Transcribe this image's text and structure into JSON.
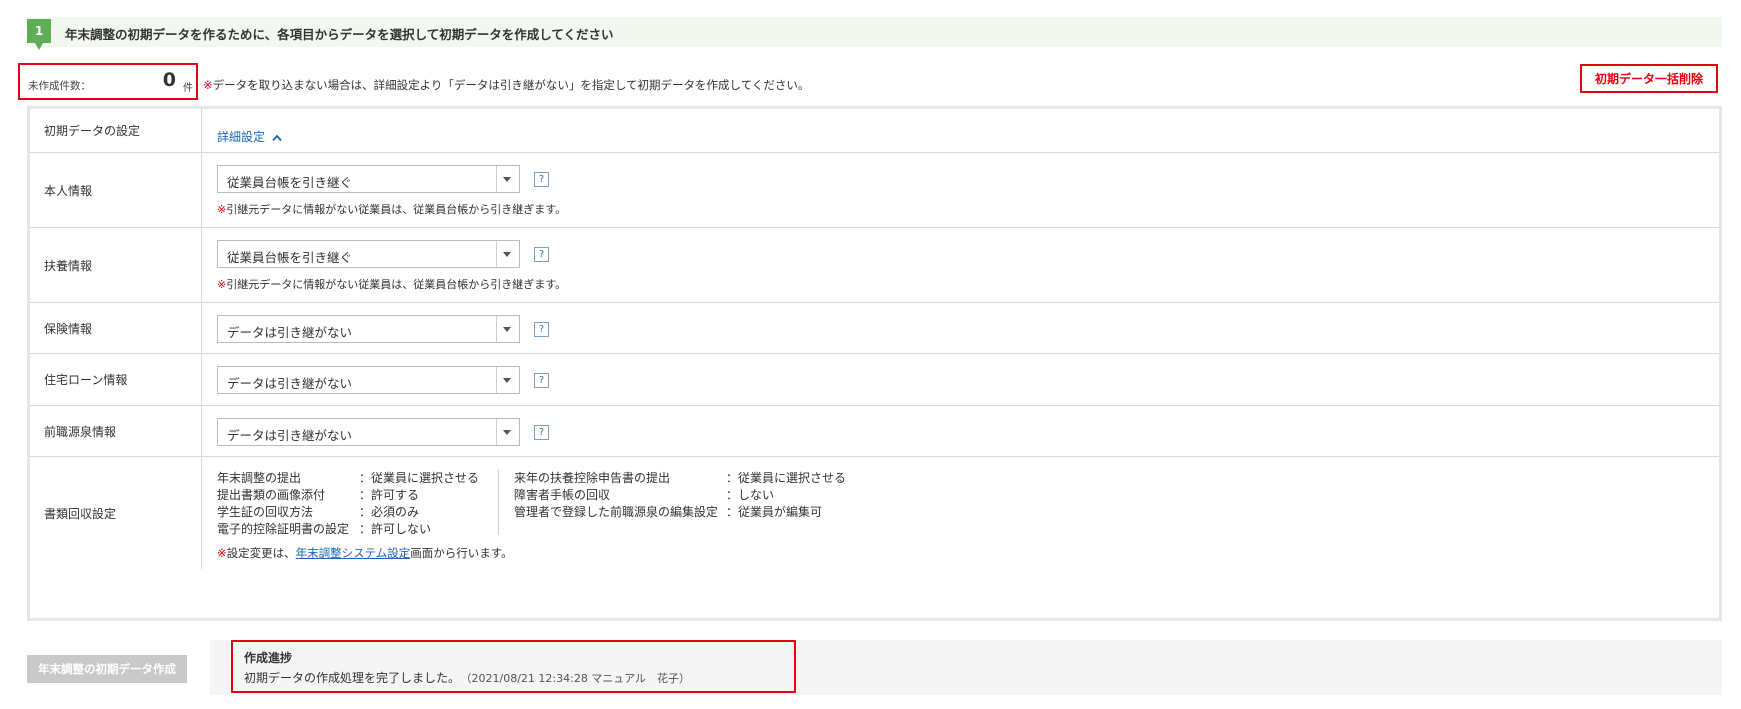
{
  "step": {
    "number": "1",
    "title": "年末調整の初期データを作るために、各項目からデータを選択して初期データを作成してください"
  },
  "uncreated": {
    "label": "未作成件数：",
    "value": "0",
    "unit": "件"
  },
  "notice": {
    "mark": "※",
    "text": "データを取り込まない場合は、詳細設定より「データは引き継がない」を指定して初期データを作成してください。"
  },
  "bulk_delete_label": "初期データ一括削除",
  "rows": {
    "initial": {
      "label": "初期データの設定",
      "link": "詳細設定"
    },
    "personal": {
      "label": "本人情報",
      "selected": "従業員台帳を引き継ぐ",
      "help": "?",
      "note_mark": "※",
      "note": "引継元データに情報がない従業員は、従業員台帳から引き継ぎます。"
    },
    "dependents": {
      "label": "扶養情報",
      "selected": "従業員台帳を引き継ぐ",
      "help": "?",
      "note_mark": "※",
      "note": "引継元データに情報がない従業員は、従業員台帳から引き継ぎます。"
    },
    "insurance": {
      "label": "保険情報",
      "selected": "データは引き継がない",
      "help": "?"
    },
    "housing_loan": {
      "label": "住宅ローン情報",
      "selected": "データは引き継がない",
      "help": "?"
    },
    "previous_job": {
      "label": "前職源泉情報",
      "selected": "データは引き継がない",
      "help": "?"
    },
    "documents": {
      "label": "書類回収設定",
      "left": [
        {
          "key": "年末調整の提出",
          "value": "：従業員に選択させる"
        },
        {
          "key": "提出書類の画像添付",
          "value": "：許可する"
        },
        {
          "key": "学生証の回収方法",
          "value": "：必須のみ"
        },
        {
          "key": "電子的控除証明書の設定",
          "value": "：許可しない"
        }
      ],
      "right": [
        {
          "key": "来年の扶養控除申告書の提出",
          "value": "：従業員に選択させる"
        },
        {
          "key": "障害者手帳の回収",
          "value": "：しない"
        },
        {
          "key": "管理者で登録した前職源泉の編集設定",
          "value": "：従業員が編集可"
        }
      ],
      "note_mark": "※",
      "note_prefix": "設定変更は、",
      "note_link": "年末調整システム設定",
      "note_suffix": "画面から行います。"
    }
  },
  "create_button_label": "年末調整の初期データ作成",
  "progress": {
    "title": "作成進捗",
    "message": "初期データの作成処理を完了しました。",
    "detail": "（2021/08/21 12:34:28 マニュアル　花子）"
  },
  "colors": {
    "accent_green": "#5fad56",
    "highlight_red": "#e60012",
    "link_blue": "#1e64b4"
  }
}
